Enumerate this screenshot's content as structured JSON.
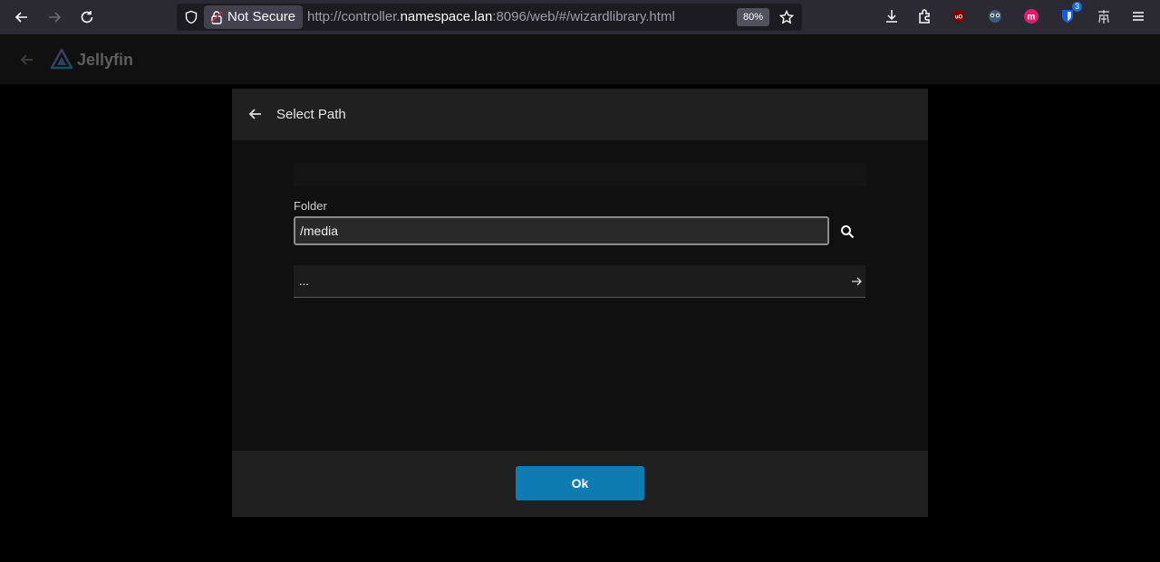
{
  "browser": {
    "not_secure_label": "Not Secure",
    "url_prefix": "http://controller.",
    "url_host": "namespace.lan",
    "url_suffix": ":8096/web/#/wizardlibrary.html",
    "zoom": "80%",
    "extension_badge": "3"
  },
  "app": {
    "logo_text": "Jellyfin"
  },
  "dialog": {
    "title": "Select Path",
    "folder_label": "Folder",
    "folder_value": "/media",
    "directory_items": [
      {
        "label": "..."
      }
    ],
    "ok_label": "Ok"
  },
  "colors": {
    "accent": "#0f7bb3",
    "dialog_bg": "#101010",
    "header_bg": "#202020"
  }
}
